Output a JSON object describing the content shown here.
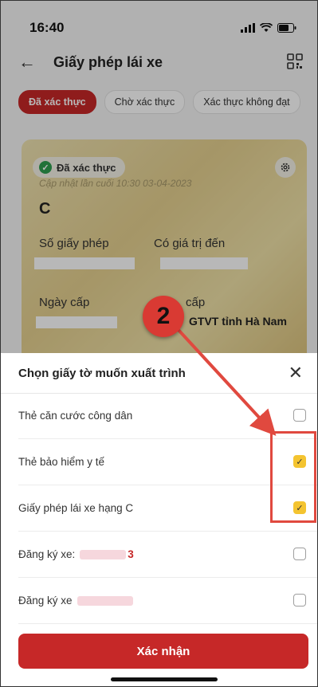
{
  "status_bar": {
    "time": "16:40"
  },
  "header": {
    "title": "Giấy phép lái xe"
  },
  "tabs": [
    {
      "label": "Đã xác thực",
      "active": true
    },
    {
      "label": "Chờ xác thực",
      "active": false
    },
    {
      "label": "Xác thực không đạt",
      "active": false
    }
  ],
  "card": {
    "badge": "Đã xác thực",
    "updated": "Cập nhật lần cuối 10:30 03-04-2023",
    "class": "C",
    "license_no_label": "Số giấy phép",
    "valid_until_label": "Có giá trị đến",
    "issue_date_label": "Ngày cấp",
    "issuer_label": "cấp",
    "issuer_value": "GTVT tỉnh Hà Nam"
  },
  "sheet": {
    "title": "Chọn giấy tờ muốn xuất trình",
    "items": [
      {
        "label": "Thẻ căn cước công dân",
        "checked": false
      },
      {
        "label": "Thẻ bảo hiểm y tế",
        "checked": true
      },
      {
        "label": "Giấy phép lái xe hạng C",
        "checked": true
      },
      {
        "label": "Đăng ký xe:",
        "suffix": "3",
        "checked": false
      },
      {
        "label": "Đăng ký xe",
        "suffix": "",
        "checked": false
      }
    ],
    "confirm_label": "Xác nhận"
  },
  "annotation": {
    "step": "2"
  },
  "colors": {
    "primary": "#c62828",
    "checkbox_checked": "#f4c430",
    "verified": "#2e9e4f",
    "annotation": "#e0493f"
  }
}
